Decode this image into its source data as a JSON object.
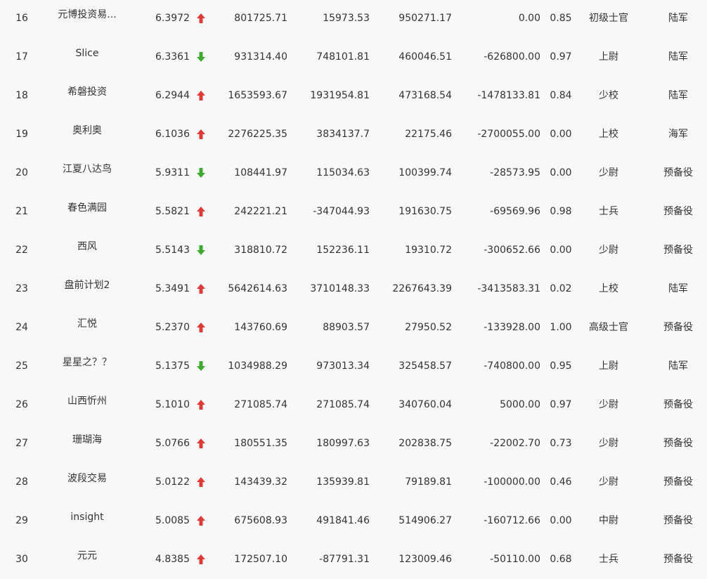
{
  "colors": {
    "up": "#e03a36",
    "down": "#3daa2e",
    "background": "#f7f8fa",
    "text": "#333333"
  },
  "rows": [
    {
      "rank": "16",
      "name": "元博投资易...",
      "score": "6.3972",
      "trend": "up",
      "v1": "801725.71",
      "v2": "15973.53",
      "v3": "950271.17",
      "v4": "0.00",
      "ratio": "0.85",
      "title": "初级士官",
      "branch": "陆军"
    },
    {
      "rank": "17",
      "name": "Slice",
      "score": "6.3361",
      "trend": "down",
      "v1": "931314.40",
      "v2": "748101.81",
      "v3": "460046.51",
      "v4": "-626800.00",
      "ratio": "0.97",
      "title": "上尉",
      "branch": "陆军"
    },
    {
      "rank": "18",
      "name": "希磐投资",
      "score": "6.2944",
      "trend": "up",
      "v1": "1653593.67",
      "v2": "1931954.81",
      "v3": "473168.54",
      "v4": "-1478133.81",
      "ratio": "0.84",
      "title": "少校",
      "branch": "陆军"
    },
    {
      "rank": "19",
      "name": "奥利奥",
      "score": "6.1036",
      "trend": "up",
      "v1": "2276225.35",
      "v2": "3834137.7",
      "v3": "22175.46",
      "v4": "-2700055.00",
      "ratio": "0.00",
      "title": "上校",
      "branch": "海军"
    },
    {
      "rank": "20",
      "name": "江夏八达鸟",
      "score": "5.9311",
      "trend": "down",
      "v1": "108441.97",
      "v2": "115034.63",
      "v3": "100399.74",
      "v4": "-28573.95",
      "ratio": "0.00",
      "title": "少尉",
      "branch": "预备役"
    },
    {
      "rank": "21",
      "name": "春色满园",
      "score": "5.5821",
      "trend": "up",
      "v1": "242221.21",
      "v2": "-347044.93",
      "v3": "191630.75",
      "v4": "-69569.96",
      "ratio": "0.98",
      "title": "士兵",
      "branch": "预备役"
    },
    {
      "rank": "22",
      "name": "西风",
      "score": "5.5143",
      "trend": "down",
      "v1": "318810.72",
      "v2": "152236.11",
      "v3": "19310.72",
      "v4": "-300652.66",
      "ratio": "0.00",
      "title": "少尉",
      "branch": "预备役"
    },
    {
      "rank": "23",
      "name": "盘前计划2",
      "score": "5.3491",
      "trend": "up",
      "v1": "5642614.63",
      "v2": "3710148.33",
      "v3": "2267643.39",
      "v4": "-3413583.31",
      "ratio": "0.02",
      "title": "上校",
      "branch": "陆军"
    },
    {
      "rank": "24",
      "name": "汇悦",
      "score": "5.2370",
      "trend": "up",
      "v1": "143760.69",
      "v2": "88903.57",
      "v3": "27950.52",
      "v4": "-133928.00",
      "ratio": "1.00",
      "title": "高级士官",
      "branch": "预备役"
    },
    {
      "rank": "25",
      "name": "星星之？？",
      "score": "5.1375",
      "trend": "down",
      "v1": "1034988.29",
      "v2": "973013.34",
      "v3": "325458.57",
      "v4": "-740800.00",
      "ratio": "0.95",
      "title": "上尉",
      "branch": "陆军"
    },
    {
      "rank": "26",
      "name": "山西忻州",
      "score": "5.1010",
      "trend": "up",
      "v1": "271085.74",
      "v2": "271085.74",
      "v3": "340760.04",
      "v4": "5000.00",
      "ratio": "0.97",
      "title": "少尉",
      "branch": "预备役"
    },
    {
      "rank": "27",
      "name": "珊瑚海",
      "score": "5.0766",
      "trend": "up",
      "v1": "180551.35",
      "v2": "180997.63",
      "v3": "202838.75",
      "v4": "-22002.70",
      "ratio": "0.73",
      "title": "少尉",
      "branch": "预备役"
    },
    {
      "rank": "28",
      "name": "波段交易",
      "score": "5.0122",
      "trend": "up",
      "v1": "143439.32",
      "v2": "135939.81",
      "v3": "79189.81",
      "v4": "-100000.00",
      "ratio": "0.46",
      "title": "少尉",
      "branch": "预备役"
    },
    {
      "rank": "29",
      "name": "insight",
      "score": "5.0085",
      "trend": "up",
      "v1": "675608.93",
      "v2": "491841.46",
      "v3": "514906.27",
      "v4": "-160712.66",
      "ratio": "0.00",
      "title": "中尉",
      "branch": "预备役"
    },
    {
      "rank": "30",
      "name": "元元",
      "score": "4.8385",
      "trend": "up",
      "v1": "172507.10",
      "v2": "-87791.31",
      "v3": "123009.46",
      "v4": "-50110.00",
      "ratio": "0.68",
      "title": "士兵",
      "branch": "预备役"
    }
  ]
}
